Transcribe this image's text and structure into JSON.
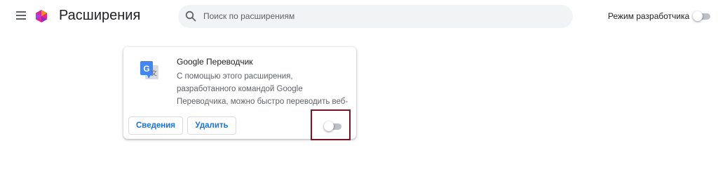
{
  "header": {
    "title": "Расширения",
    "search_placeholder": "Поиск по расширениям",
    "dev_mode_label": "Режим разработчика",
    "dev_mode_enabled": false
  },
  "extension": {
    "name": "Google Переводчик",
    "description": "С помощью этого расширения,\nразработанного командой Google\nПереводчика, можно быстро переводить веб-",
    "details_label": "Сведения",
    "remove_label": "Удалить",
    "enabled": false
  },
  "colors": {
    "accent": "#1a73e8",
    "highlight_border": "#7a1523",
    "search_bg": "#f1f3f4"
  },
  "icons": {
    "menu": "hamburger-menu-icon",
    "logo": "extensions-logo-icon",
    "search": "search-icon",
    "extension": "google-translate-icon"
  }
}
